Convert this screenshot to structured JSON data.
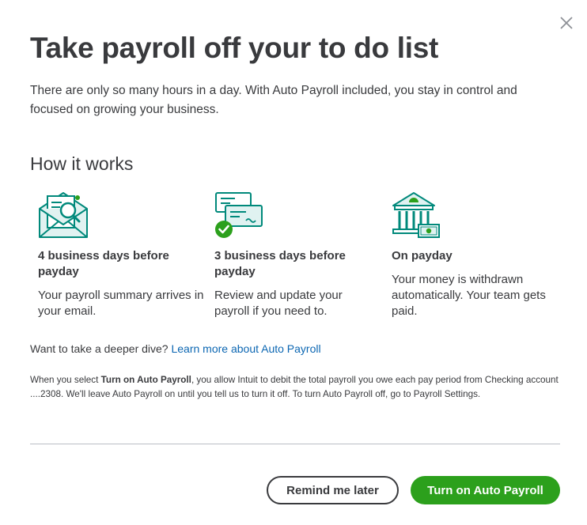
{
  "dialog": {
    "title": "Take payroll off your to do list",
    "intro": "There are only so many hours in a day. With Auto Payroll included, you stay in control and focused on growing your business.",
    "subheading": "How it works"
  },
  "steps": [
    {
      "icon": "envelope-search-icon",
      "title": "4 business days before payday",
      "text": "Your payroll summary arrives in your email."
    },
    {
      "icon": "checks-review-icon",
      "title": "3 business days before payday",
      "text": "Review and update your payroll if you need to."
    },
    {
      "icon": "bank-payment-icon",
      "title": "On payday",
      "text": "Your money is withdrawn automatically. Your team gets paid."
    }
  ],
  "deeper_dive": {
    "prompt": "Want to take a deeper dive?",
    "link": "Learn more about Auto Payroll"
  },
  "legal": {
    "prefix": "When you select ",
    "emphasis": "Turn on Auto Payroll",
    "suffix": ", you allow Intuit to debit the total payroll you owe each pay period from Checking account ....2308. We'll leave Auto Payroll on until you tell us to turn it off. To turn Auto Payroll off, go to Payroll Settings."
  },
  "buttons": {
    "remind": "Remind me later",
    "turn_on": "Turn on Auto Payroll"
  },
  "colors": {
    "accent_green": "#2ca01c",
    "icon_teal": "#00897b",
    "link_blue": "#0b66b2",
    "text": "#393a3d"
  }
}
